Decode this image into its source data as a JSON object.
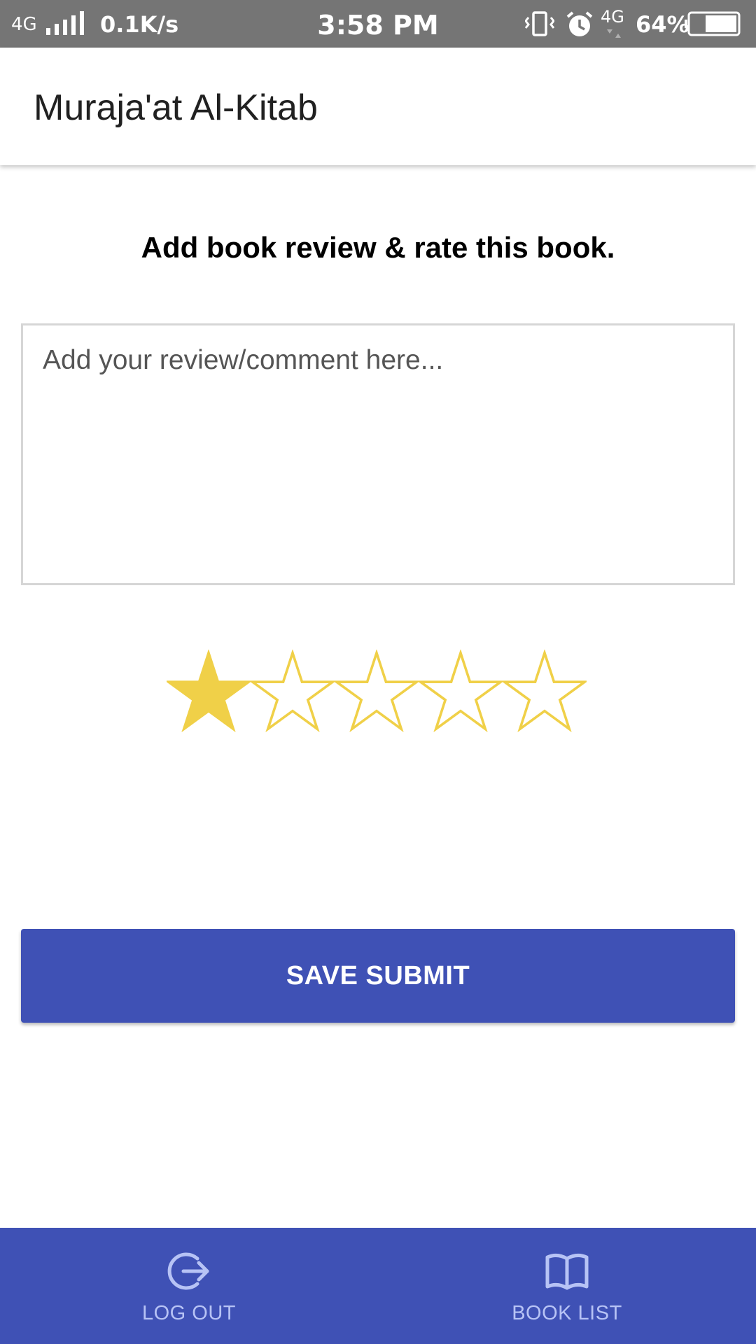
{
  "status_bar": {
    "network_left": "4G",
    "speed": "0.1K/s",
    "time": "3:58 PM",
    "network_right": "4G",
    "battery": "64%",
    "icons": [
      "signal-icon",
      "vibrate-icon",
      "alarm-icon",
      "data-arrows-icon",
      "battery-icon"
    ]
  },
  "app_bar": {
    "title": "Muraja'at Al-Kitab"
  },
  "main": {
    "heading": "Add book review & rate this book.",
    "review_placeholder": "Add your review/comment here...",
    "review_value": "",
    "rating": {
      "value": 1,
      "max": 5
    },
    "save_label": "SAVE SUBMIT"
  },
  "bottom_nav": {
    "items": [
      {
        "label": "LOG OUT",
        "icon": "logout-icon"
      },
      {
        "label": "BOOK LIST",
        "icon": "book-icon"
      }
    ]
  },
  "colors": {
    "primary": "#3f51b5",
    "status_bar": "#757575",
    "star": "#f0d048",
    "nav_text": "#b7c3f5"
  }
}
